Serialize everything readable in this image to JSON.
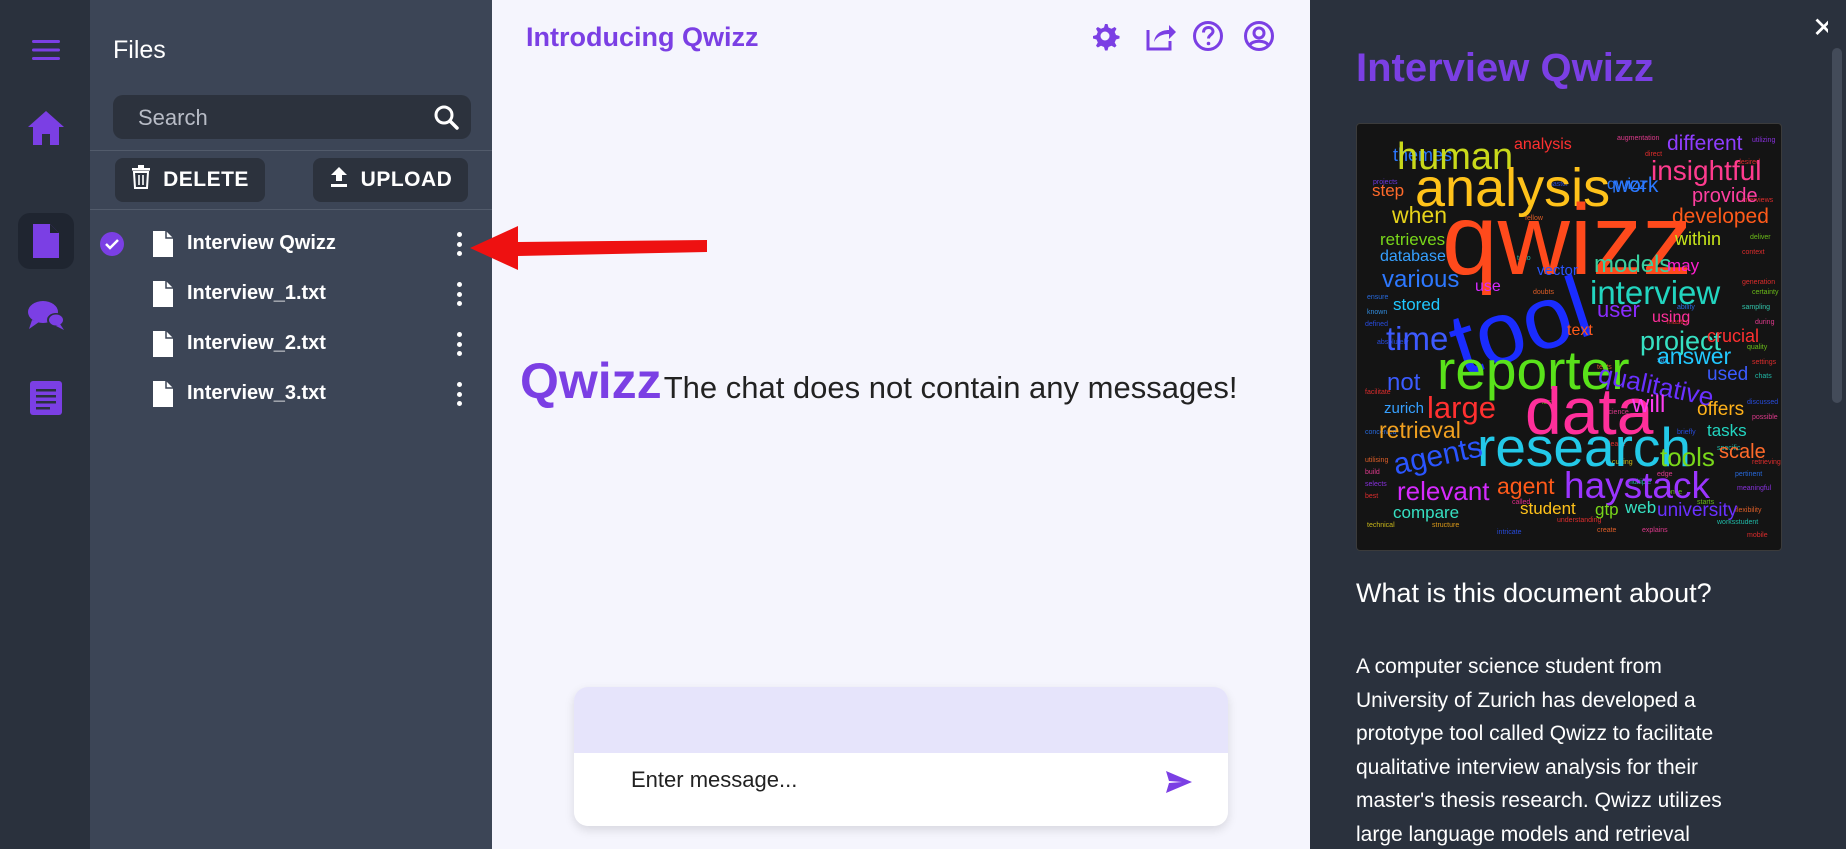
{
  "files_panel": {
    "title": "Files",
    "search": {
      "placeholder": "Search"
    },
    "buttons": {
      "delete": "DELETE",
      "upload": "UPLOAD"
    },
    "items": [
      {
        "name": "Interview Qwizz",
        "selected": true
      },
      {
        "name": "Interview_1.txt",
        "selected": false
      },
      {
        "name": "Interview_2.txt",
        "selected": false
      },
      {
        "name": "Interview_3.txt",
        "selected": false
      }
    ]
  },
  "main": {
    "title": "Introducing Qwizz",
    "empty_logo": "Qwizz",
    "empty_message": "The chat does not contain any messages!",
    "composer": {
      "placeholder": "Enter message..."
    }
  },
  "doc_panel": {
    "title": "Interview Qwizz",
    "question": "What is this document about?",
    "body": "A computer science student from University of Zurich has developed a prototype tool called Qwizz to facilitate qualitative interview analysis for their master's thesis research. Qwizz utilizes large language models and retrieval"
  },
  "wordcloud": [
    {
      "text": "qwizz",
      "color": "#ff4a1c"
    },
    {
      "text": "analysis",
      "color": "#ffc21a"
    },
    {
      "text": "tool",
      "color": "#1a2cff"
    },
    {
      "text": "reporter",
      "color": "#59e21a"
    },
    {
      "text": "data",
      "color": "#ff2f9b"
    },
    {
      "text": "research",
      "color": "#23c9e8"
    },
    {
      "text": "haystack",
      "color": "#9b35ff"
    },
    {
      "text": "human",
      "color": "#c9d91a"
    },
    {
      "text": "interview",
      "color": "#22d5c0"
    },
    {
      "text": "insightful",
      "color": "#ff3b8e"
    },
    {
      "text": "models",
      "color": "#3ad1a0"
    },
    {
      "text": "qualitative",
      "color": "#6a30ff"
    },
    {
      "text": "large",
      "color": "#ff3030"
    },
    {
      "text": "retrieval",
      "color": "#f0a020"
    },
    {
      "text": "agents",
      "color": "#2a55ff"
    },
    {
      "text": "relevant",
      "color": "#d62aff"
    },
    {
      "text": "agent",
      "color": "#ff5a1a"
    },
    {
      "text": "tools",
      "color": "#79d71a"
    },
    {
      "text": "project",
      "color": "#36e0c2"
    },
    {
      "text": "answer",
      "color": "#22c8ff"
    },
    {
      "text": "various",
      "color": "#2d78ff"
    },
    {
      "text": "time",
      "color": "#3d5aff"
    },
    {
      "text": "when",
      "color": "#e6d21a"
    },
    {
      "text": "user",
      "color": "#8a2cff"
    },
    {
      "text": "will",
      "color": "#ff3df0"
    },
    {
      "text": "not",
      "color": "#3b5bff"
    },
    {
      "text": "different",
      "color": "#8f3dff"
    },
    {
      "text": "developed",
      "color": "#ff5a1a"
    },
    {
      "text": "provide",
      "color": "#ff3fa0"
    },
    {
      "text": "within",
      "color": "#c9e61a"
    },
    {
      "text": "may",
      "color": "#ff1fd0"
    },
    {
      "text": "database",
      "color": "#36a0ff"
    },
    {
      "text": "stored",
      "color": "#20c8ff"
    },
    {
      "text": "retrieves",
      "color": "#79d71a"
    },
    {
      "text": "step",
      "color": "#ff6a2a"
    },
    {
      "text": "themes",
      "color": "#2a78ff"
    },
    {
      "text": "work",
      "color": "#2a78ff"
    },
    {
      "text": "offers",
      "color": "#ffb21a"
    },
    {
      "text": "tasks",
      "color": "#22d5c0"
    },
    {
      "text": "scale",
      "color": "#ff6a2a"
    },
    {
      "text": "used",
      "color": "#3b5bff"
    },
    {
      "text": "crucial",
      "color": "#ff3030"
    },
    {
      "text": "using",
      "color": "#ff2f9b"
    },
    {
      "text": "text",
      "color": "#ff5a1a"
    },
    {
      "text": "vector",
      "color": "#2a55ff"
    },
    {
      "text": "use",
      "color": "#d62aff"
    },
    {
      "text": "zurich",
      "color": "#22c8ff"
    },
    {
      "text": "compare",
      "color": "#36e0c2"
    },
    {
      "text": "student",
      "color": "#ffc21a"
    },
    {
      "text": "gtp",
      "color": "#79d71a"
    },
    {
      "text": "web",
      "color": "#36e0c2"
    },
    {
      "text": "university",
      "color": "#6a30ff"
    }
  ]
}
